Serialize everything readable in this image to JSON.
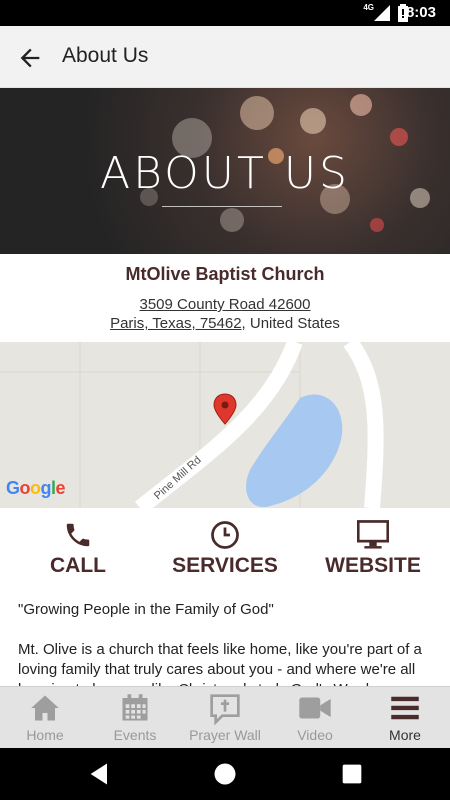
{
  "status_bar": {
    "network": "4G",
    "time": "8:03"
  },
  "app_bar": {
    "title": "About Us"
  },
  "hero": {
    "heading": "ABOUT US"
  },
  "church": {
    "name": "MtOlive Baptist Church",
    "address_line1": "3509 County Road 42600",
    "address_city": "Paris, Texas, 75462",
    "address_country": ", United States"
  },
  "map": {
    "road_label": "Pine Mill Rd",
    "brand": [
      "G",
      "o",
      "o",
      "g",
      "l",
      "e"
    ],
    "brand_colors": [
      "#4285F4",
      "#EA4335",
      "#FBBC05",
      "#4285F4",
      "#34A853",
      "#EA4335"
    ],
    "marker_color": "#e0372c",
    "water_color": "#a7c8f0"
  },
  "actions": {
    "call": "CALL",
    "services": "SERVICES",
    "website": "WEBSITE"
  },
  "content": {
    "tagline": "\"Growing People in the Family of God\"",
    "description": "Mt. Olive is a church that feels like home, like you're part of a loving family that truly cares about you - and where we're all learning to be more like Christ and study God's Word."
  },
  "bottom_nav": {
    "items": [
      {
        "label": "Home",
        "icon": "home-icon"
      },
      {
        "label": "Events",
        "icon": "calendar-icon"
      },
      {
        "label": "Prayer Wall",
        "icon": "prayer-wall-icon"
      },
      {
        "label": "Video",
        "icon": "video-camera-icon"
      },
      {
        "label": "More",
        "icon": "menu-icon"
      }
    ],
    "active": "More"
  },
  "colors": {
    "accent": "#4a2b2b",
    "appbar": "#f2f2f2",
    "nav_bg": "#e3e3e3",
    "nav_icon": "#9e9e9e"
  }
}
